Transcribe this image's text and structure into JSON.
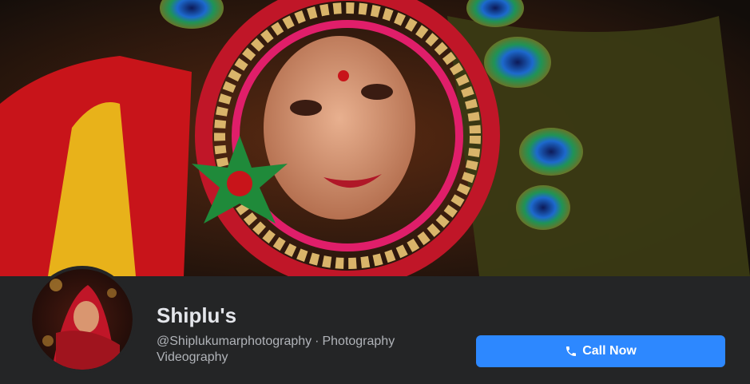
{
  "page": {
    "name": "Shiplu's",
    "handle": "@Shiplukumarphotography",
    "separator": "·",
    "category": "Photography Videography"
  },
  "actions": {
    "call_label": "Call Now",
    "call_icon": "phone-icon"
  },
  "colors": {
    "background": "#242526",
    "primary_button": "#2d88ff",
    "name_text": "#e4e6eb",
    "meta_text": "#b0b3b8"
  }
}
